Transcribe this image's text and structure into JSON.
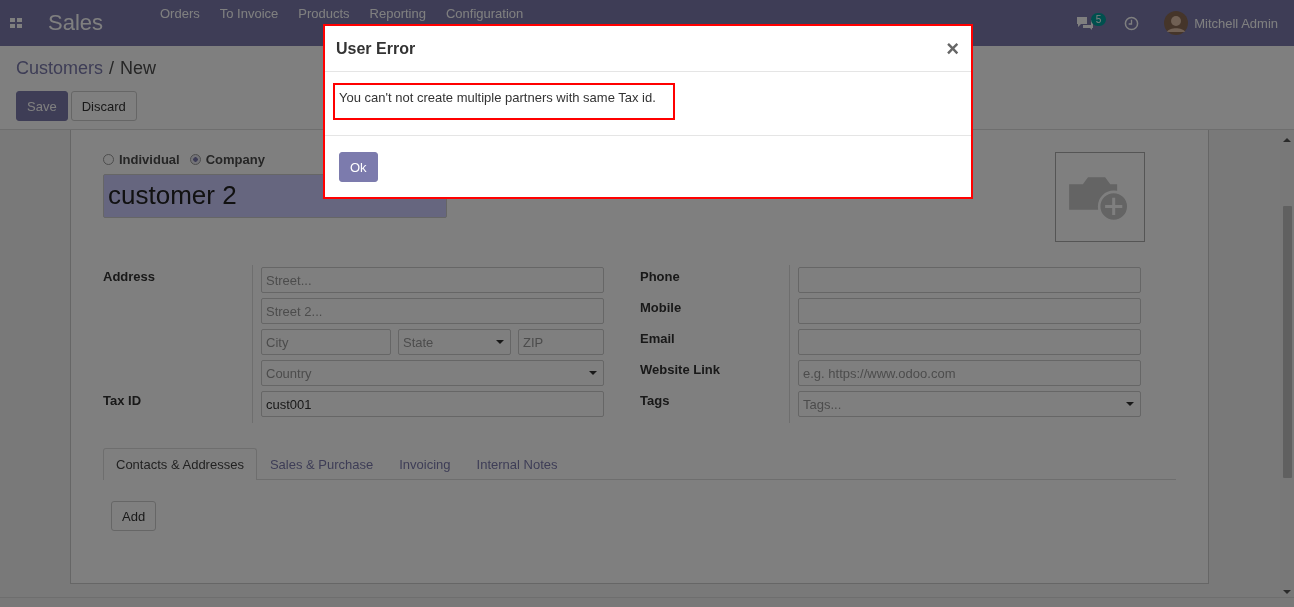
{
  "navbar": {
    "app_name": "Sales",
    "menu": [
      "Orders",
      "To Invoice",
      "Products",
      "Reporting",
      "Configuration"
    ],
    "messages_badge": "5",
    "user": "Mitchell Admin"
  },
  "breadcrumb": {
    "items": [
      "Customers",
      "New"
    ],
    "separator": "/"
  },
  "buttons": [
    {
      "label": "Save",
      "kind": "primary"
    },
    {
      "label": "Discard",
      "kind": "secondary"
    }
  ],
  "form": {
    "company_type": [
      {
        "label": "Individual",
        "selected": false
      },
      {
        "label": "Company",
        "selected": true
      }
    ],
    "name": "customer 2",
    "address_label": "Address",
    "street": {
      "placeholder": "Street..."
    },
    "street2": {
      "placeholder": "Street 2..."
    },
    "city": {
      "placeholder": "City"
    },
    "state": {
      "placeholder": "State"
    },
    "zip": {
      "placeholder": "ZIP"
    },
    "country": {
      "placeholder": "Country"
    },
    "tax_id": {
      "label": "Tax ID",
      "value": "cust001"
    },
    "right_fields": [
      {
        "label": "Phone",
        "kind": "text"
      },
      {
        "label": "Mobile",
        "kind": "text"
      },
      {
        "label": "Email",
        "kind": "text"
      },
      {
        "label": "Website Link",
        "kind": "text",
        "placeholder": "e.g. https://www.odoo.com"
      },
      {
        "label": "Tags",
        "kind": "select",
        "placeholder": "Tags..."
      }
    ],
    "tabs": [
      {
        "label": "Contacts & Addresses",
        "selected": true
      },
      {
        "label": "Sales & Purchase",
        "selected": false
      },
      {
        "label": "Invoicing",
        "selected": false
      },
      {
        "label": "Internal Notes",
        "selected": false
      }
    ],
    "add_button": "Add"
  },
  "dialog": {
    "title": "User Error",
    "close": "×",
    "message": "You can't not create multiple partners with same Tax id.",
    "ok": "Ok"
  }
}
